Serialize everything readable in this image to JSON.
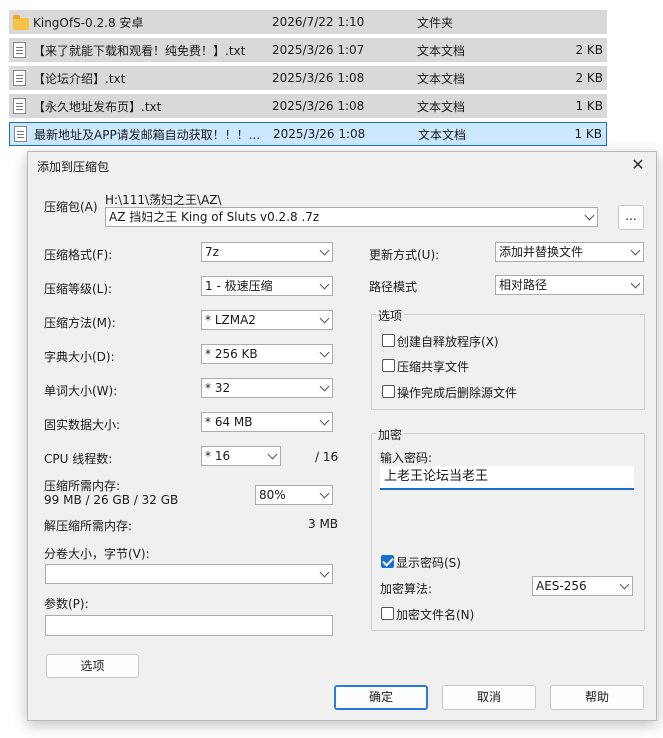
{
  "files": [
    {
      "name": "KingOfS-0.2.8 安卓",
      "date": "2026/7/22 1:10",
      "type": "文件夹",
      "size": "",
      "icon": "folder-icon"
    },
    {
      "name": "【来了就能下载和观看！纯免费！】.txt",
      "date": "2025/3/26 1:07",
      "type": "文本文档",
      "size": "2 KB",
      "icon": "text-file-icon"
    },
    {
      "name": "【论坛介绍】.txt",
      "date": "2025/3/26 1:08",
      "type": "文本文档",
      "size": "2 KB",
      "icon": "text-file-icon"
    },
    {
      "name": "【永久地址发布页】.txt",
      "date": "2025/3/26 1:08",
      "type": "文本文档",
      "size": "1 KB",
      "icon": "text-file-icon"
    },
    {
      "name": "最新地址及APP请发邮箱自动获取！！！....",
      "date": "2025/3/26 1:08",
      "type": "文本文档",
      "size": "1 KB",
      "icon": "text-file-icon"
    }
  ],
  "dialog": {
    "title": "添加到压缩包",
    "close": "✕",
    "archive_label": "压缩包(A)",
    "archive_path": "H:\\111\\荡妇之王\\AZ\\",
    "archive_name": "AZ 挡妇之王 King of Sluts  v0.2.8 .7z",
    "browse": "...",
    "format_label": "压缩格式(F):",
    "format_value": "7z",
    "level_label": "压缩等级(L):",
    "level_value": "1 - 极速压缩",
    "method_label": "压缩方法(M):",
    "method_value": "*  LZMA2",
    "dict_label": "字典大小(D):",
    "dict_value": "*  256 KB",
    "word_label": "单词大小(W):",
    "word_value": "*  32",
    "solid_label": "固实数据大小:",
    "solid_value": "*  64 MB",
    "cpu_label": "CPU 线程数:",
    "cpu_value": "*  16",
    "cpu_total": "/ 16",
    "mem_label": "压缩所需内存:",
    "mem_detail": "99 MB / 26 GB / 32 GB",
    "mem_value": "80%",
    "decomp_label": "解压缩所需内存:",
    "decomp_value": "3 MB",
    "split_label": "分卷大小，字节(V):",
    "split_value": "",
    "params_label": "参数(P):",
    "params_value": "",
    "options_button": "选项",
    "update_label": "更新方式(U):",
    "update_value": "添加并替换文件",
    "path_label": "路径模式",
    "path_value": "相对路径",
    "options_group": "选项",
    "opt_sfx": "创建自释放程序(X)",
    "opt_shared": "压缩共享文件",
    "opt_delete": "操作完成后删除源文件",
    "enc_group": "加密",
    "pwd_label": "输入密码:",
    "pwd_value": "上老王论坛当老王",
    "show_pwd": "显示密码(S)",
    "enc_method_label": "加密算法:",
    "enc_method_value": "AES-256",
    "enc_names": "加密文件名(N)",
    "ok": "确定",
    "cancel": "取消",
    "help": "帮助"
  },
  "colors": {
    "accent": "#1b6fd0",
    "file_row_bg": "#d9d9d9",
    "selected_bg": "#cce8ff"
  }
}
